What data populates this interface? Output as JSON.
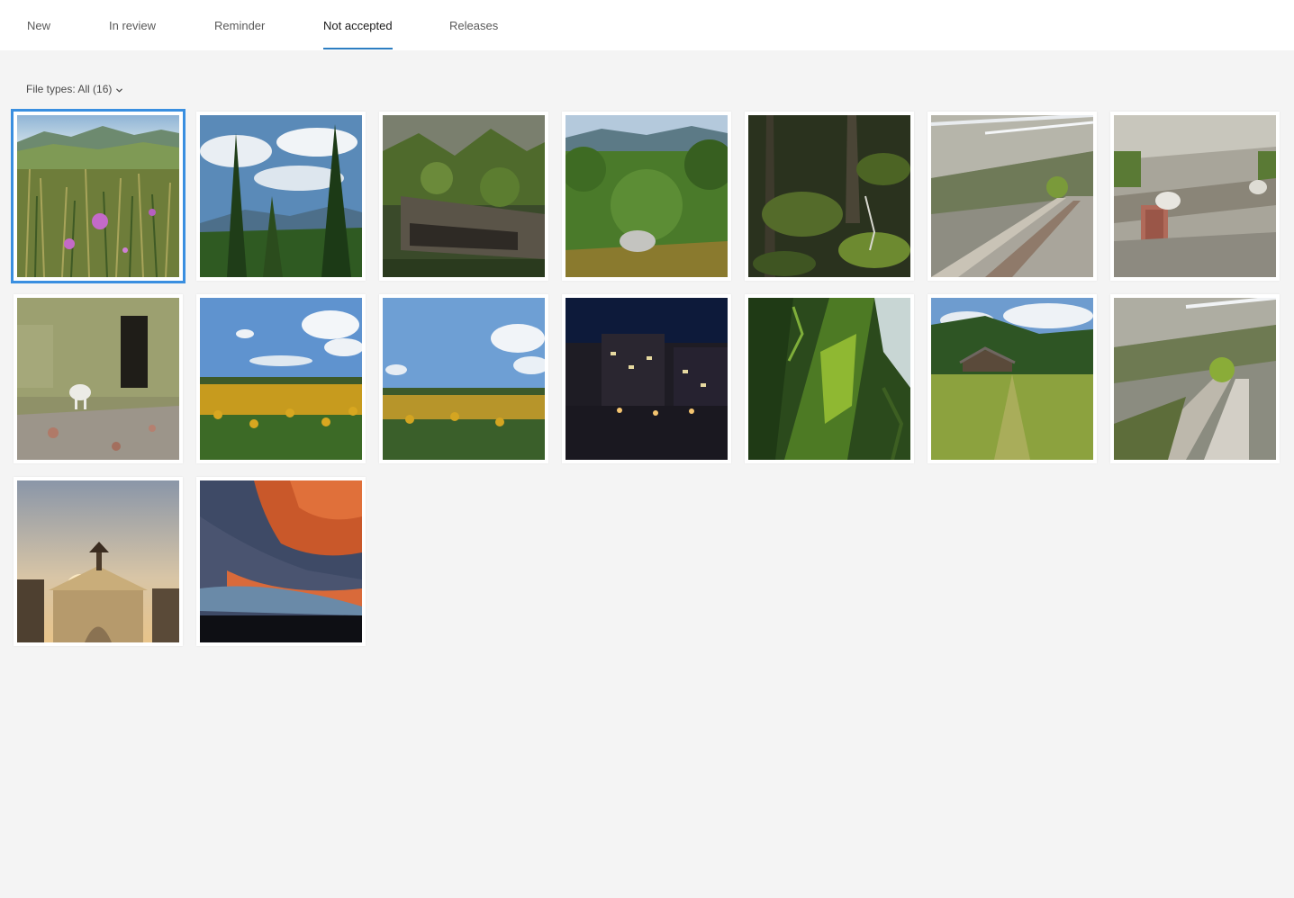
{
  "tabs": [
    {
      "label": "New",
      "active": false
    },
    {
      "label": "In review",
      "active": false
    },
    {
      "label": "Reminder",
      "active": false
    },
    {
      "label": "Not accepted",
      "active": true
    },
    {
      "label": "Releases",
      "active": false
    }
  ],
  "filter": {
    "label": "File types: All (16)",
    "icon": "chevron-down-icon"
  },
  "accent_color": "#2d7ec2",
  "selection_color": "#3a8fe0",
  "thumbnails": [
    {
      "scene": "meadow-wildflowers-mountains",
      "selected": true
    },
    {
      "scene": "forest-fir-trees-sky",
      "selected": false
    },
    {
      "scene": "rocky-forest-roots",
      "selected": false
    },
    {
      "scene": "green-valley-mountains",
      "selected": false
    },
    {
      "scene": "mossy-forest-floor",
      "selected": false
    },
    {
      "scene": "abandoned-barn-interior",
      "selected": false
    },
    {
      "scene": "barn-interior-goat",
      "selected": false
    },
    {
      "scene": "ruined-building-goat",
      "selected": false
    },
    {
      "scene": "sunflower-field-clouds",
      "selected": false
    },
    {
      "scene": "sunflower-field-sky",
      "selected": false
    },
    {
      "scene": "city-street-night",
      "selected": false
    },
    {
      "scene": "moss-covered-tree-trunk",
      "selected": false
    },
    {
      "scene": "mountain-hut-green-hill",
      "selected": false
    },
    {
      "scene": "abandoned-barn-corridor",
      "selected": false
    },
    {
      "scene": "monument-arch-sunset",
      "selected": false
    },
    {
      "scene": "orange-sunset-clouds",
      "selected": false
    }
  ]
}
